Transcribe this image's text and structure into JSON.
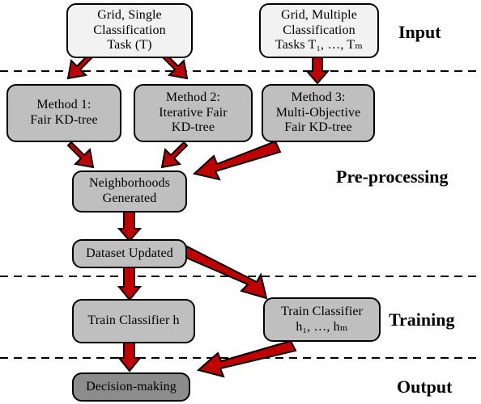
{
  "diagram": {
    "title_colors": {
      "arrow_fill": "#c00000",
      "arrow_stroke": "#000000",
      "box_light": "#f2f2f2",
      "box_gray": "#bfbfbf",
      "box_dark": "#8c8c8c",
      "divider": "#000000",
      "background": "#ffffff"
    },
    "stages": [
      {
        "id": "input",
        "label": "Input"
      },
      {
        "id": "pre-processing",
        "label": "Pre-processing"
      },
      {
        "id": "training",
        "label": "Training"
      },
      {
        "id": "output",
        "label": "Output"
      }
    ],
    "nodes": [
      {
        "id": "grid-single",
        "label": "Grid, Single\nClassification\nTask (T)"
      },
      {
        "id": "grid-multiple",
        "label": "Grid, Multiple\nClassification\nTasks T₁, …, Tₘ"
      },
      {
        "id": "method-1",
        "label": "Method 1:\nFair KD-tree"
      },
      {
        "id": "method-2",
        "label": "Method 2:\nIterative Fair\nKD-tree"
      },
      {
        "id": "method-3",
        "label": "Method 3:\nMulti-Objective\nFair KD-tree"
      },
      {
        "id": "neighborhoods",
        "label": "Neighborhoods\nGenerated"
      },
      {
        "id": "dataset-updated",
        "label": "Dataset Updated"
      },
      {
        "id": "train-classifier-h",
        "label": "Train Classifier h"
      },
      {
        "id": "train-classifier-hm",
        "label": "Train Classifier\nh₁, …, hₘ"
      },
      {
        "id": "decision-making",
        "label": "Decision-making"
      }
    ],
    "edges": [
      {
        "id": "edge-single-to-method1",
        "from": "grid-single",
        "to": "method-1"
      },
      {
        "id": "edge-single-to-method2",
        "from": "grid-single",
        "to": "method-2"
      },
      {
        "id": "edge-multiple-to-method3",
        "from": "grid-multiple",
        "to": "method-3"
      },
      {
        "id": "edge-method1-to-neighborhoods",
        "from": "method-1",
        "to": "neighborhoods"
      },
      {
        "id": "edge-method2-to-neighborhoods",
        "from": "method-2",
        "to": "neighborhoods"
      },
      {
        "id": "edge-method3-to-neighborhoods",
        "from": "method-3",
        "to": "neighborhoods"
      },
      {
        "id": "edge-neighborhoods-to-dataset",
        "from": "neighborhoods",
        "to": "dataset-updated"
      },
      {
        "id": "edge-dataset-to-classifier-h",
        "from": "dataset-updated",
        "to": "train-classifier-h"
      },
      {
        "id": "edge-dataset-to-classifier-hm",
        "from": "dataset-updated",
        "to": "train-classifier-hm"
      },
      {
        "id": "edge-classifier-h-to-decision",
        "from": "train-classifier-h",
        "to": "decision-making"
      },
      {
        "id": "edge-classifier-hm-to-decision",
        "from": "train-classifier-hm",
        "to": "decision-making"
      }
    ]
  }
}
